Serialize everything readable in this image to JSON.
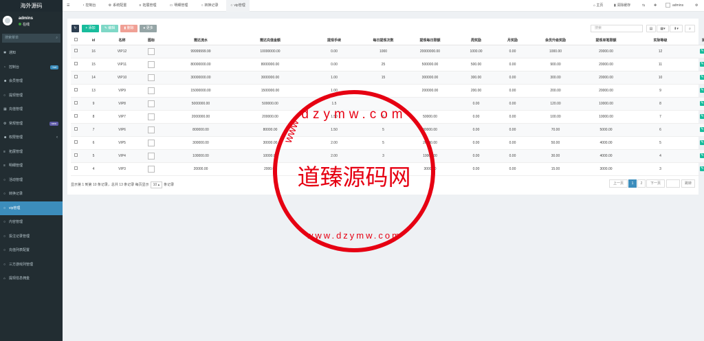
{
  "app": {
    "logo": "海外源码"
  },
  "user": {
    "name": "admins",
    "status": "在线"
  },
  "sidebar": {
    "search_placeholder": "搜索菜单",
    "items": [
      {
        "label": "通知",
        "icon": "snowflake-icon"
      },
      {
        "label": "控制台",
        "icon": "dashboard-icon",
        "badge": "hot",
        "badge_color": "#3c8dbc"
      },
      {
        "label": "会员管理",
        "icon": "users-icon"
      },
      {
        "label": "提现管理",
        "icon": "circle-icon"
      },
      {
        "label": "充值管理",
        "icon": "grid-icon"
      },
      {
        "label": "常规管理",
        "icon": "cogs-icon",
        "badge": "new",
        "badge_color": "#605ca8"
      },
      {
        "label": "权限管理",
        "icon": "users-icon",
        "arrow": "‹"
      },
      {
        "label": "拓展管理",
        "icon": "list-icon"
      },
      {
        "label": "明细管理",
        "icon": "list-icon"
      },
      {
        "label": "活动管理",
        "icon": "circle-icon"
      },
      {
        "label": "转换记录",
        "icon": "circle-icon"
      },
      {
        "label": "vip管理",
        "icon": "circle-icon",
        "active": true
      },
      {
        "label": "内容管理",
        "icon": "circle-icon"
      },
      {
        "label": "投注记录管理",
        "icon": "circle-icon"
      },
      {
        "label": "充值列表配置",
        "icon": "circle-icon"
      },
      {
        "label": "三方游戏列管理",
        "icon": "circle-icon"
      },
      {
        "label": "提现信息佣金",
        "icon": "bank-icon"
      }
    ]
  },
  "topbar": {
    "tabs": [
      {
        "label": "控制台",
        "icon": "dashboard-icon"
      },
      {
        "label": "系统配置",
        "icon": "gear-icon"
      },
      {
        "label": "拓展管理",
        "icon": "list-icon"
      },
      {
        "label": "明细管理",
        "icon": "calendar-icon"
      },
      {
        "label": "转换记录",
        "icon": "circle-icon"
      },
      {
        "label": "vip管理",
        "icon": "circle-icon",
        "active": true
      }
    ],
    "right": {
      "home": "主页",
      "clear_cache": "清除缓存",
      "user": "admins"
    }
  },
  "toolbar": {
    "add": "添加",
    "edit": "编辑",
    "delete": "删除",
    "more": "更多",
    "search_placeholder": "搜索"
  },
  "colors": {
    "accent": "#3c8dbc",
    "green": "#18bc9c",
    "red": "#e74c3c",
    "gray": "#95a5a6",
    "dark": "#2c3e50",
    "stamp_red": "#e60012"
  },
  "table": {
    "columns": [
      "id",
      "名称",
      "图标",
      "需达流水",
      "需达充值金额",
      "提现手续",
      "每日提现次数",
      "提现每日限额",
      "周奖励",
      "月奖励",
      "会员升级奖励",
      "提现单笔限额",
      "实际等级",
      "操作"
    ],
    "rows": [
      {
        "id": "16",
        "name": "VIP12",
        "turnover": "99999999.99",
        "recharge": "10000000.00",
        "fee": "0.00",
        "times": "1000",
        "daily": "20000000.00",
        "week": "1000.00",
        "month": "0.00",
        "upgrade": "1000.00",
        "single": "20000.00",
        "level": "12"
      },
      {
        "id": "15",
        "name": "VIP11",
        "turnover": "80000000.00",
        "recharge": "8000000.00",
        "fee": "0.00",
        "times": "25",
        "daily": "500000.00",
        "week": "500.00",
        "month": "0.00",
        "upgrade": "900.00",
        "single": "20000.00",
        "level": "11"
      },
      {
        "id": "14",
        "name": "VIP10",
        "turnover": "30000000.00",
        "recharge": "3000000.00",
        "fee": "1.00",
        "times": "15",
        "daily": "300000.00",
        "week": "300.00",
        "month": "0.00",
        "upgrade": "300.00",
        "single": "20000.00",
        "level": "10"
      },
      {
        "id": "13",
        "name": "VIP9",
        "turnover": "15000000.00",
        "recharge": "1500000.00",
        "fee": "1.00",
        "times": "",
        "daily": "200000.00",
        "week": "200.00",
        "month": "0.00",
        "upgrade": "200.00",
        "single": "20000.00",
        "level": "9"
      },
      {
        "id": "9",
        "name": "VIP8",
        "turnover": "5000000.00",
        "recharge": "500000.00",
        "fee": "1.5",
        "times": "",
        "daily": "",
        "week": "0.00",
        "month": "0.00",
        "upgrade": "120.00",
        "single": "10000.00",
        "level": "8"
      },
      {
        "id": "8",
        "name": "VIP7",
        "turnover": "2000000.00",
        "recharge": "200000.00",
        "fee": "1.50",
        "times": "6",
        "daily": "50000.00",
        "week": "0.00",
        "month": "0.00",
        "upgrade": "100.00",
        "single": "10000.00",
        "level": "7"
      },
      {
        "id": "7",
        "name": "VIP6",
        "turnover": "800000.00",
        "recharge": "80000.00",
        "fee": "1.50",
        "times": "5",
        "daily": "30000.00",
        "week": "0.00",
        "month": "0.00",
        "upgrade": "70.00",
        "single": "5000.00",
        "level": "6"
      },
      {
        "id": "6",
        "name": "VIP5",
        "turnover": "300000.00",
        "recharge": "30000.00",
        "fee": "2.00",
        "times": "5",
        "daily": "20000.00",
        "week": "0.00",
        "month": "0.00",
        "upgrade": "50.00",
        "single": "4000.00",
        "level": "5"
      },
      {
        "id": "5",
        "name": "VIP4",
        "turnover": "100000.00",
        "recharge": "10000.00",
        "fee": "2.00",
        "times": "3",
        "daily": "10000.00",
        "week": "0.00",
        "month": "0.00",
        "upgrade": "30.00",
        "single": "4000.00",
        "level": "4"
      },
      {
        "id": "4",
        "name": "VIP3",
        "turnover": "20000.00",
        "recharge": "2000.00",
        "fee": "",
        "times": "",
        "daily": "3000.00",
        "week": "0.00",
        "month": "0.00",
        "upgrade": "15.00",
        "single": "3000.00",
        "level": "3"
      }
    ]
  },
  "footer": {
    "info_prefix": "显示第 1 到第 10 条记录，总共 13 条记录 每页显示",
    "page_size": "10",
    "info_suffix": "条记录"
  },
  "pagination": {
    "prev": "上一页",
    "pages": [
      "1",
      "2"
    ],
    "current": "1",
    "next": "下一页",
    "goto": "跳转"
  },
  "watermark": {
    "text": "道臻源码网",
    "top_text": "dzymw.com",
    "bottom_text": "www.dzymw.com",
    "left_text": "www"
  }
}
